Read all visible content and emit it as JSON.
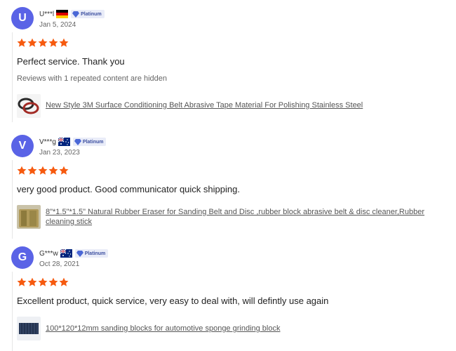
{
  "reviews": [
    {
      "avatar_letter": "U",
      "username": "U***l",
      "badge": "Platinum",
      "date": "Jan 5, 2024",
      "rating": 5,
      "text": "Perfect service. Thank you",
      "hidden_note": "Reviews with 1 repeated content are hidden",
      "product": "New Style 3M Surface Conditioning Belt Abrasive Tape Material For Polishing Stainless Steel"
    },
    {
      "avatar_letter": "V",
      "username": "V***g",
      "badge": "Platinum",
      "date": "Jan 23, 2023",
      "rating": 5,
      "text": "very good product. Good communicator quick shipping.",
      "product": "8\"*1.5\"*1.5\" Natural Rubber Eraser for Sanding Belt and Disc ,rubber block abrasive belt & disc cleaner,Rubber cleaning stick"
    },
    {
      "avatar_letter": "G",
      "username": "G***w",
      "badge": "Platinum",
      "date": "Oct 28, 2021",
      "rating": 5,
      "text": "Excellent product, quick service, very easy to deal with, will defintly use again",
      "product": "100*120*12mm sanding blocks for automotive sponge grinding block"
    }
  ],
  "colors": {
    "star": "#f65a0f",
    "avatar": "#5a63e6",
    "badge_text": "#3c4fa0"
  }
}
